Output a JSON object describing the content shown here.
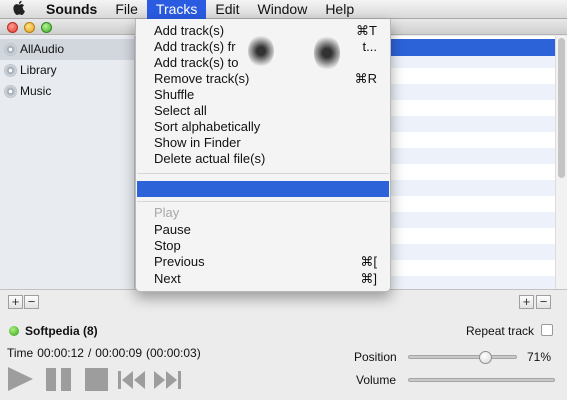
{
  "menubar": {
    "app_name": "Sounds",
    "items": [
      "File",
      "Tracks",
      "Edit",
      "Window",
      "Help"
    ],
    "active_item": "Tracks"
  },
  "sidebar": {
    "items": [
      {
        "label": "AllAudio",
        "selected": true
      },
      {
        "label": "Library",
        "selected": false
      },
      {
        "label": "Music",
        "selected": false
      }
    ]
  },
  "tracks_menu": {
    "group1": [
      {
        "label": "Add track(s)",
        "shortcut": "⌘T"
      },
      {
        "label": "Add track(s) fr",
        "shortcut": "t..."
      },
      {
        "label": "Add track(s) to",
        "shortcut": ""
      },
      {
        "label": "Remove track(s)",
        "shortcut": "⌘R"
      },
      {
        "label": "Shuffle",
        "shortcut": ""
      },
      {
        "label": "Select all",
        "shortcut": ""
      },
      {
        "label": "Sort alphabetically",
        "shortcut": ""
      },
      {
        "label": "Show in Finder",
        "shortcut": ""
      },
      {
        "label": "Delete actual file(s)",
        "shortcut": ""
      }
    ],
    "group2": [
      {
        "label": "Play",
        "shortcut": "",
        "disabled": true
      },
      {
        "label": "Pause",
        "shortcut": ""
      },
      {
        "label": "Stop",
        "shortcut": ""
      },
      {
        "label": "Previous",
        "shortcut": "⌘["
      },
      {
        "label": "Next",
        "shortcut": "⌘]"
      }
    ]
  },
  "player": {
    "playlist": "Softpedia (8)",
    "repeat_label": "Repeat track",
    "repeat_checked": false,
    "time_label": "Time",
    "elapsed": "00:00:12",
    "sep": "/",
    "duration": "00:00:09",
    "remaining": "(00:00:03)",
    "position_label": "Position",
    "position_pct": "71%",
    "position_value": 0.71,
    "volume_label": "Volume",
    "add_symbol": "+",
    "remove_symbol": "−"
  },
  "colors": {
    "selection": "#2c63d9",
    "status_dot": "#2e9b16"
  },
  "icons": {
    "apple": "apple-logo-icon",
    "sidebar": "speaker-icon",
    "controls": [
      "play-icon",
      "pause-icon",
      "stop-icon",
      "previous-icon",
      "next-icon"
    ]
  }
}
